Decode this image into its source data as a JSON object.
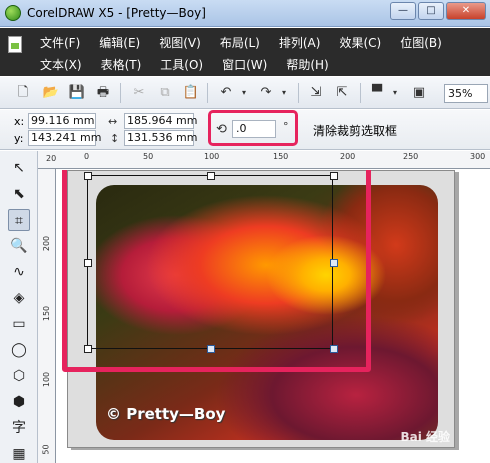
{
  "window": {
    "title": "CorelDRAW X5 - [Pretty—Boy]",
    "min_label": "—",
    "max_label": "□",
    "close_label": "✕"
  },
  "menu": {
    "row1": [
      "文件(F)",
      "编辑(E)",
      "视图(V)",
      "布局(L)",
      "排列(A)",
      "效果(C)",
      "位图(B)"
    ],
    "row2": [
      "文本(X)",
      "表格(T)",
      "工具(O)",
      "窗口(W)",
      "帮助(H)"
    ]
  },
  "toolbar": {
    "zoom": "35%"
  },
  "propbar": {
    "x_label": "x:",
    "x_value": "99.116 mm",
    "y_label": "y:",
    "y_value": "143.241 mm",
    "width_value": "185.964 mm",
    "height_value": "131.536 mm",
    "rotate_value": ".0",
    "degree_symbol": "°",
    "clear_crop_label": "清除裁剪选取框"
  },
  "ruler": {
    "h_ticks": [
      "0",
      "50",
      "100",
      "150",
      "200",
      "250",
      "300"
    ],
    "v_ticks": [
      "200",
      "150",
      "100",
      "50"
    ],
    "h_corner": "20"
  },
  "canvas": {
    "watermark": "© Pretty—Boy",
    "site_mark": "Bai 经验"
  },
  "colors": {
    "highlight": "#e6235d",
    "menubar": "#2b2b2b"
  }
}
